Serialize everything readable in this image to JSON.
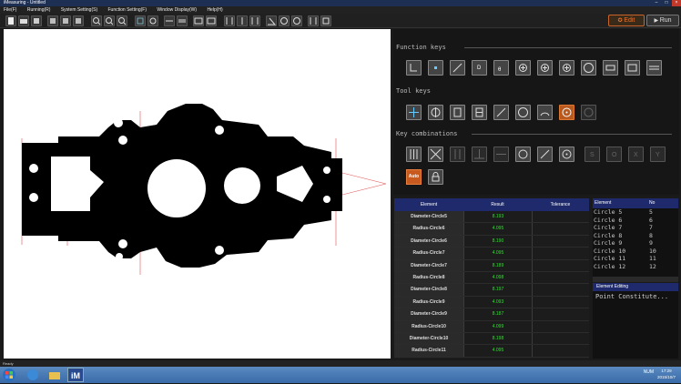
{
  "window": {
    "title": "iMeasuring - Untitled"
  },
  "menu": [
    "File(F)",
    "Running(R)",
    "System Setting(S)",
    "Function Setting(F)",
    "Window Display(W)",
    "Help(H)"
  ],
  "mode": {
    "edit_label": "Edit",
    "run_label": "Run"
  },
  "sections": {
    "function_keys": "Function keys",
    "tool_keys": "Tool keys",
    "key_combinations": "Key combinations"
  },
  "auto_label": "Auto",
  "results": {
    "headers": {
      "element": "Element",
      "result": "Result",
      "tolerance": "Tolerance"
    },
    "rows": [
      {
        "element": "Diameter-Circle5",
        "result": "8.193"
      },
      {
        "element": "Radius-Circle6",
        "result": "4.095"
      },
      {
        "element": "Diameter-Circle6",
        "result": "8.190"
      },
      {
        "element": "Radius-Circle7",
        "result": "4.095"
      },
      {
        "element": "Diameter-Circle7",
        "result": "8.189"
      },
      {
        "element": "Radius-Circle8",
        "result": "4.098"
      },
      {
        "element": "Diameter-Circle8",
        "result": "8.197"
      },
      {
        "element": "Radius-Circle9",
        "result": "4.093"
      },
      {
        "element": "Diameter-Circle9",
        "result": "8.187"
      },
      {
        "element": "Radius-Circle10",
        "result": "4.099"
      },
      {
        "element": "Diameter-Circle10",
        "result": "8.198"
      },
      {
        "element": "Radius-Circle11",
        "result": "4.095"
      }
    ]
  },
  "element_list": {
    "headers": {
      "element": "Element",
      "no": "No"
    },
    "rows": [
      {
        "name": "Circle 5",
        "no": "5"
      },
      {
        "name": "Circle 6",
        "no": "6"
      },
      {
        "name": "Circle 7",
        "no": "7"
      },
      {
        "name": "Circle 8",
        "no": "8"
      },
      {
        "name": "Circle 9",
        "no": "9"
      },
      {
        "name": "Circle 10",
        "no": "10"
      },
      {
        "name": "Circle 11",
        "no": "11"
      },
      {
        "name": "Circle 12",
        "no": "12"
      }
    ]
  },
  "element_editing": {
    "title": "Element Editing",
    "content": "Point Constitute..."
  },
  "status": {
    "text": "Ready"
  },
  "tray": {
    "num": "NUM",
    "time": "17:29",
    "date": "2015/10/7"
  },
  "colors": {
    "accent": "#e8742c",
    "header_blue": "#1e2a6c",
    "result_green": "#2de02d"
  }
}
